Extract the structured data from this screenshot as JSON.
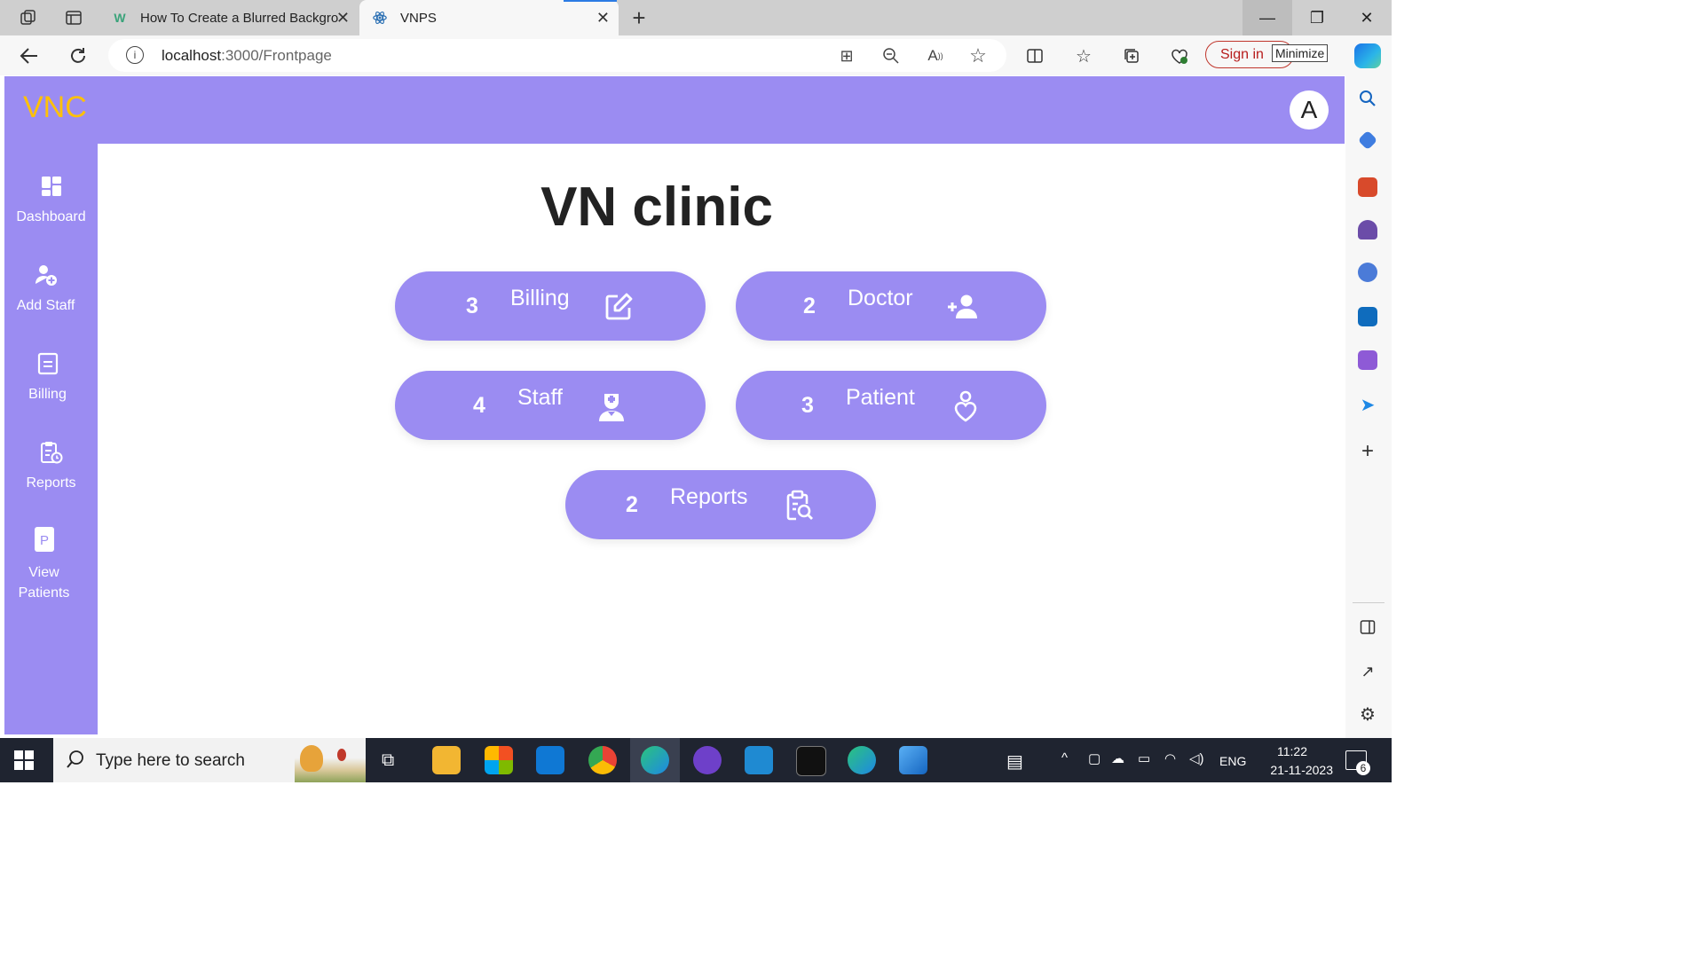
{
  "browser": {
    "tabs": [
      {
        "title": "How To Create a Blurred Backgro",
        "favicon": "w-icon"
      },
      {
        "title": "VNPS",
        "favicon": "react-icon",
        "active": true
      }
    ],
    "url_host": "localhost",
    "url_path": ":3000/Frontpage",
    "signin_label": "Sign in",
    "tooltip": "Minimize"
  },
  "app": {
    "logo": "VNC",
    "avatar_letter": "A",
    "title": "VN clinic",
    "sidebar": [
      {
        "label": "Dashboard",
        "icon": "dashboard-icon"
      },
      {
        "label": "Add Staff",
        "icon": "add-staff-icon"
      },
      {
        "label": "Billing",
        "icon": "billing-icon"
      },
      {
        "label": "Reports",
        "icon": "reports-icon"
      },
      {
        "label": "View Patients",
        "icon": "patients-icon"
      }
    ],
    "cards": [
      {
        "count": "3",
        "label": "Billing",
        "icon": "edit-icon"
      },
      {
        "count": "2",
        "label": "Doctor",
        "icon": "user-plus-icon"
      },
      {
        "count": "4",
        "label": "Staff",
        "icon": "nurse-icon"
      },
      {
        "count": "3",
        "label": "Patient",
        "icon": "patient-heart-icon"
      },
      {
        "count": "2",
        "label": "Reports",
        "icon": "report-search-icon"
      }
    ],
    "colors": {
      "primary": "#9b8cf2",
      "logo": "#ffc107"
    }
  },
  "taskbar": {
    "search_placeholder": "Type here to search",
    "language": "ENG",
    "time": "11:22",
    "date": "21-11-2023",
    "notification_count": "6"
  }
}
